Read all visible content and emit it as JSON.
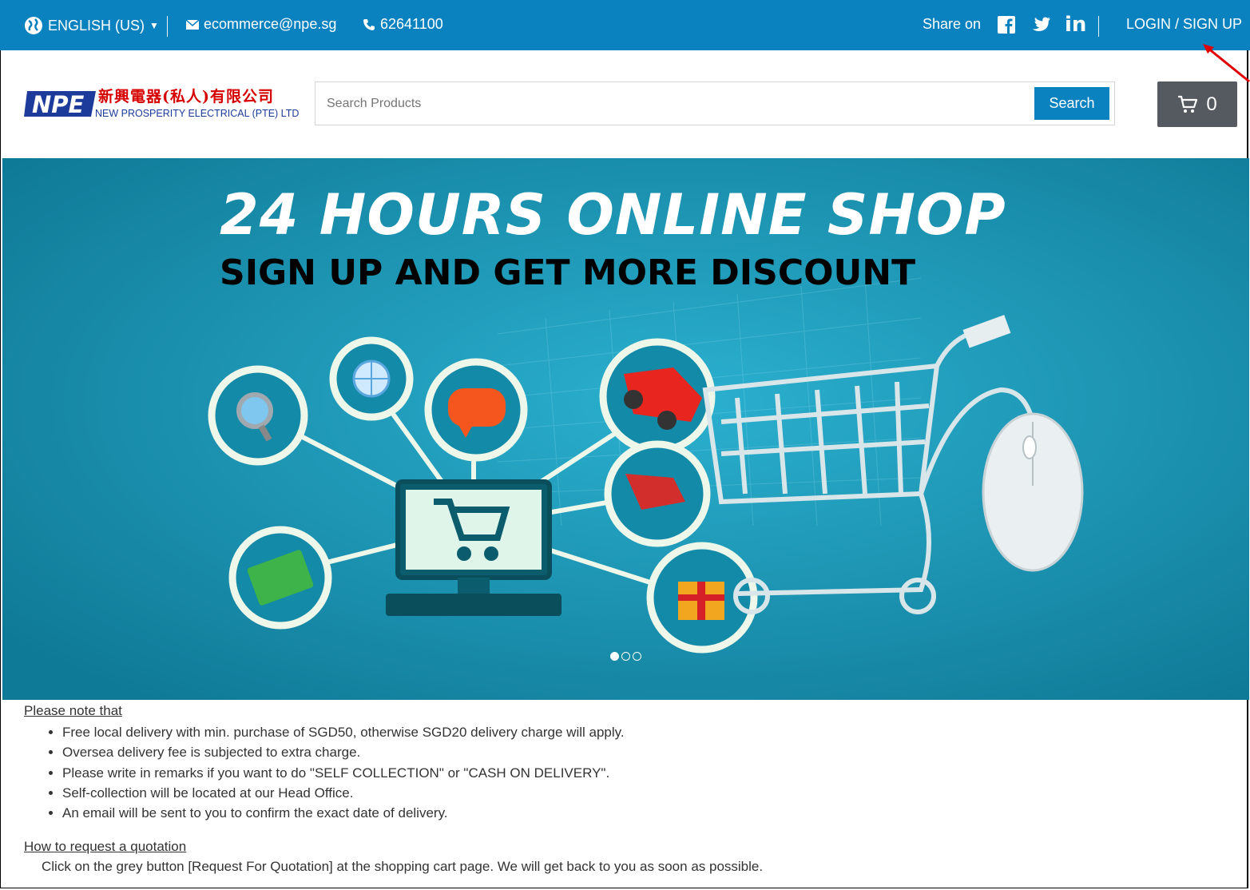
{
  "topbar": {
    "language": "ENGLISH (US)",
    "email": "ecommerce@npe.sg",
    "phone": "62641100",
    "share_label": "Share on",
    "social": {
      "facebook": "facebook-icon",
      "twitter": "twitter-icon",
      "linkedin": "linkedin-icon",
      "linkedin_text": "in"
    },
    "login_label": "LOGIN / SIGN UP"
  },
  "brand": {
    "logo_mark": "NPE",
    "chinese_name": "新興電器(私人)有限公司",
    "english_name": "NEW PROSPERITY ELECTRICAL (PTE) LTD"
  },
  "search": {
    "placeholder": "Search Products",
    "button_label": "Search"
  },
  "cart": {
    "count": "0"
  },
  "banner": {
    "title": "24 HOURS ONLINE SHOP",
    "subtitle": "SIGN UP AND GET MORE DISCOUNT",
    "slides_total": 3,
    "active_slide": 1
  },
  "notes": {
    "heading": "Please note that",
    "items": [
      "Free local delivery with min. purchase of SGD50, otherwise SGD20 delivery charge will apply.",
      "Oversea delivery fee is subjected to extra charge.",
      "Please write in remarks if you want to do \"SELF COLLECTION\" or \"CASH ON DELIVERY\".",
      "Self-collection will be located at our Head Office.",
      "An email will be sent to you to confirm the exact date of delivery."
    ]
  },
  "quotation": {
    "heading": "How to request a quotation",
    "text": "Click on the grey button [Request For Quotation] at the shopping cart page. We will get back to you as soon as possible."
  },
  "colors": {
    "topbar": "#0a82c0",
    "banner": "#1a95b3",
    "cart_button": "#555a60",
    "annotation_arrow": "#e00000"
  }
}
